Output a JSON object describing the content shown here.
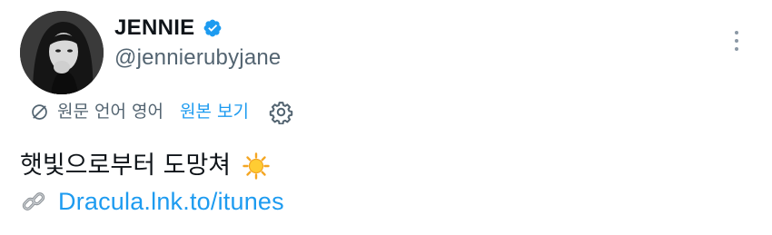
{
  "user": {
    "display_name": "JENNIE",
    "handle": "@jennierubyjane",
    "verified_color": "#1d9bf0"
  },
  "translate": {
    "note": "원문 언어 영어",
    "show_original": "원본 보기"
  },
  "tweet": {
    "text": "햇빛으로부터 도망쳐",
    "emoji": "sun-icon",
    "link_text": "Dracula.lnk.to/itunes",
    "link_icon": "link-icon"
  },
  "colors": {
    "accent": "#1d9bf0",
    "secondary_text": "#536471",
    "primary_text": "#0f1419"
  }
}
